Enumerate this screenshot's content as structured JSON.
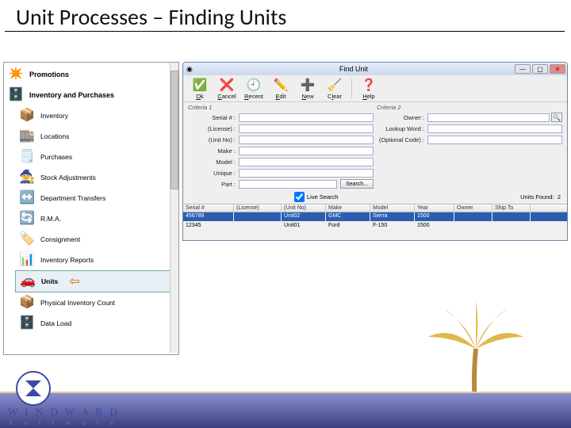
{
  "slide": {
    "title": "Unit Processes – Finding Units"
  },
  "sidebar": {
    "headings": {
      "promotions": "Promotions",
      "inventory_group": "Inventory and Purchases"
    },
    "items": [
      {
        "icon": "📦",
        "label": "Inventory"
      },
      {
        "icon": "🏬",
        "label": "Locations"
      },
      {
        "icon": "🗒️",
        "label": "Purchases"
      },
      {
        "icon": "🧙",
        "label": "Stock Adjustments"
      },
      {
        "icon": "↔️",
        "label": "Department Transfers"
      },
      {
        "icon": "🔄",
        "label": "R.M.A."
      },
      {
        "icon": "🏷️",
        "label": "Consignment"
      },
      {
        "icon": "📊",
        "label": "Inventory Reports"
      },
      {
        "icon": "🚗",
        "label": "Units"
      },
      {
        "icon": "📦",
        "label": "Physical Inventory Count"
      },
      {
        "icon": "🗄️",
        "label": "Data Load"
      }
    ],
    "icons": {
      "promotions": "✴️",
      "inventory_group": "🗄️"
    }
  },
  "window": {
    "title": "Find Unit",
    "toolbar": [
      {
        "icon": "✅",
        "label": "Ok",
        "u": "O"
      },
      {
        "icon": "❌",
        "label": "Cancel",
        "u": "C"
      },
      {
        "icon": "🕘",
        "label": "Recent",
        "u": "R"
      },
      {
        "icon": "✏️",
        "label": "Edit",
        "u": "E"
      },
      {
        "icon": "➕",
        "label": "New",
        "u": "N"
      },
      {
        "icon": "🧹",
        "label": "Clear",
        "u": "l"
      },
      {
        "icon": "❓",
        "label": "Help",
        "u": "H"
      }
    ],
    "criteria1_label": "Criteria 1",
    "criteria2_label": "Criteria 2",
    "fields": {
      "serial": "Serial # :",
      "license": "(License) :",
      "unitno": "(Unit No) :",
      "make": "Make :",
      "model": "Model :",
      "unique": "Unique :",
      "part": "Part :",
      "owner": "Owner :",
      "lookup": "Lookup Word :",
      "optional": "(Optional Code) :"
    },
    "search_btn": "Search...",
    "live_search": "Live Search",
    "units_found_label": "Units Found:",
    "units_found_value": "2",
    "grid": {
      "cols": [
        "Serial #",
        "(License)",
        "(Unit No)",
        "Make",
        "Model",
        "Year",
        "Owner",
        "Ship To",
        ""
      ],
      "rows": [
        [
          "456789",
          "",
          "Unit02",
          "GMC",
          "Sierra",
          "1500",
          "",
          "",
          ""
        ],
        [
          "12345",
          "",
          "Unit01",
          "Ford",
          "F-150",
          "1500",
          "",
          "",
          ""
        ]
      ]
    }
  },
  "footer": {
    "brand_top": "W I N D W A R D",
    "brand_bottom": "s o f t w a r e"
  }
}
